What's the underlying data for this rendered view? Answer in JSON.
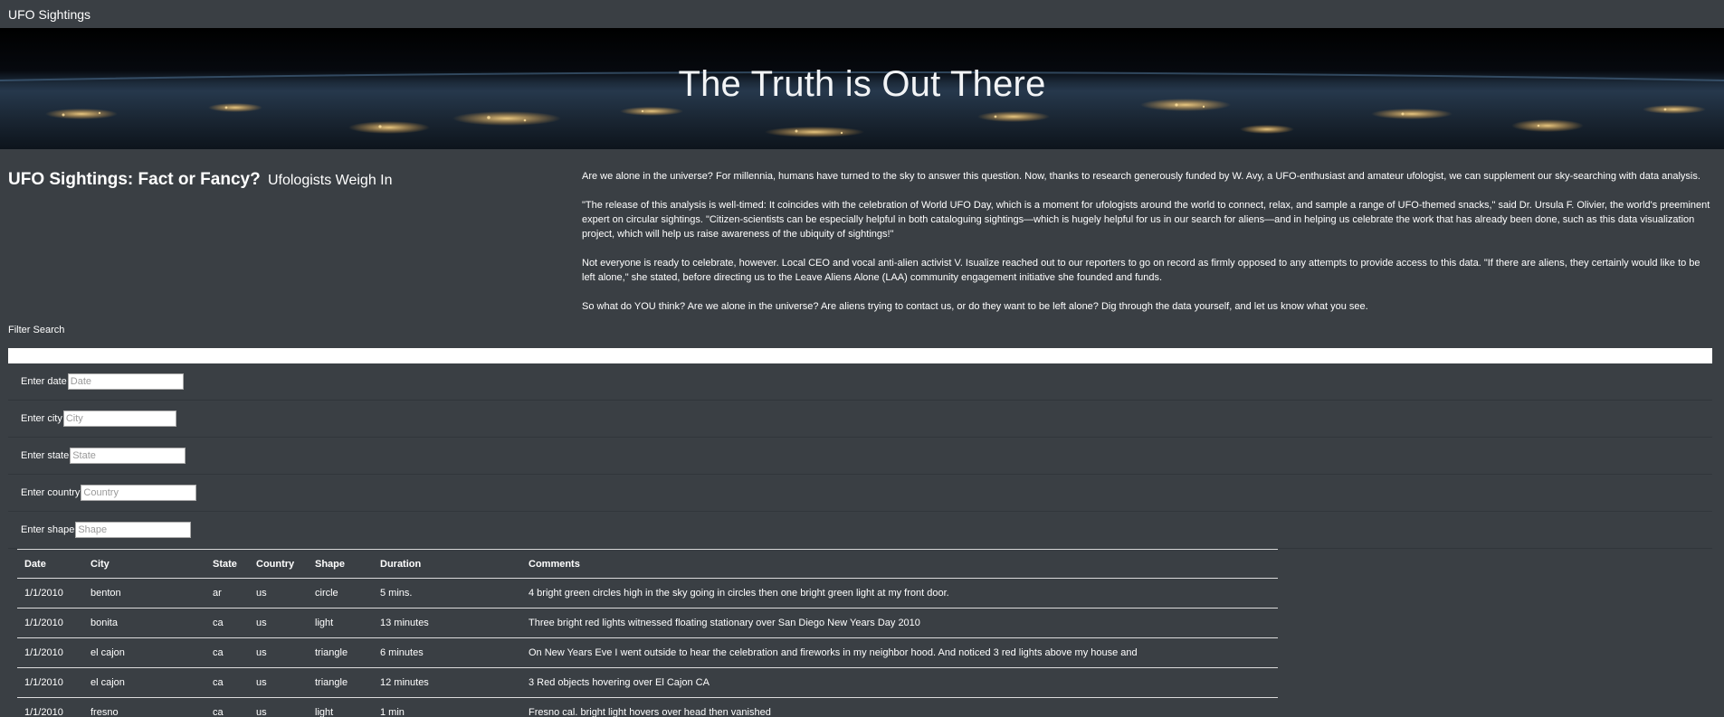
{
  "navbar": {
    "brand": "UFO Sightings"
  },
  "hero": {
    "title": "The Truth is Out There"
  },
  "intro": {
    "heading": "UFO Sightings: Fact or Fancy?",
    "subheading": "Ufologists Weigh In",
    "paragraphs": [
      "Are we alone in the universe? For millennia, humans have turned to the sky to answer this question. Now, thanks to research generously funded by W. Avy, a UFO-enthusiast and amateur ufologist, we can supplement our sky-searching with data analysis.",
      "\"The release of this analysis is well-timed: It coincides with the celebration of World UFO Day, which is a moment for ufologists around the world to connect, relax, and sample a range of UFO-themed snacks,\" said Dr. Ursula F. Olivier, the world's preeminent expert on circular sightings. \"Citizen-scientists can be especially helpful in both cataloguing sightings—which is hugely helpful for us in our search for aliens—and in helping us celebrate the work that has already been done, such as this data visualization project, which will help us raise awareness of the ubiquity of sightings!\"",
      "Not everyone is ready to celebrate, however. Local CEO and vocal anti-alien activist V. Isualize reached out to our reporters to go on record as firmly opposed to any attempts to provide access to this data. \"If there are aliens, they certainly would like to be left alone,\" she stated, before directing us to the Leave Aliens Alone (LAA) community engagement initiative she founded and funds.",
      "So what do YOU think? Are we alone in the universe? Are aliens trying to contact us, or do they want to be left alone? Dig through the data yourself, and let us know what you see."
    ]
  },
  "filters": {
    "title": "Filter Search",
    "fields": [
      {
        "label": "Enter date",
        "placeholder": "Date"
      },
      {
        "label": "Enter city",
        "placeholder": "City"
      },
      {
        "label": "Enter state",
        "placeholder": "State"
      },
      {
        "label": "Enter country",
        "placeholder": "Country"
      },
      {
        "label": "Enter shape",
        "placeholder": "Shape"
      }
    ]
  },
  "table": {
    "headers": [
      "Date",
      "City",
      "State",
      "Country",
      "Shape",
      "Duration",
      "Comments"
    ],
    "rows": [
      [
        "1/1/2010",
        "benton",
        "ar",
        "us",
        "circle",
        "5 mins.",
        "4 bright green circles high in the sky going in circles then one bright green light at my front door."
      ],
      [
        "1/1/2010",
        "bonita",
        "ca",
        "us",
        "light",
        "13 minutes",
        "Three bright red lights witnessed floating stationary over San Diego New Years Day 2010"
      ],
      [
        "1/1/2010",
        "el cajon",
        "ca",
        "us",
        "triangle",
        "6 minutes",
        "On New Years Eve I went outside to hear the celebration and fireworks in my neighbor hood. And noticed 3 red lights above my house and"
      ],
      [
        "1/1/2010",
        "el cajon",
        "ca",
        "us",
        "triangle",
        "12 minutes",
        "3 Red objects hovering over El Cajon CA"
      ],
      [
        "1/1/2010",
        "fresno",
        "ca",
        "us",
        "light",
        "1 min",
        "Fresno cal. bright light hovers over head then vanished"
      ]
    ]
  },
  "colors": {
    "page_background": "#3a3f44",
    "hero_background": "#05070b",
    "text": "#ffffff",
    "city_lights": "#f7c56a"
  }
}
